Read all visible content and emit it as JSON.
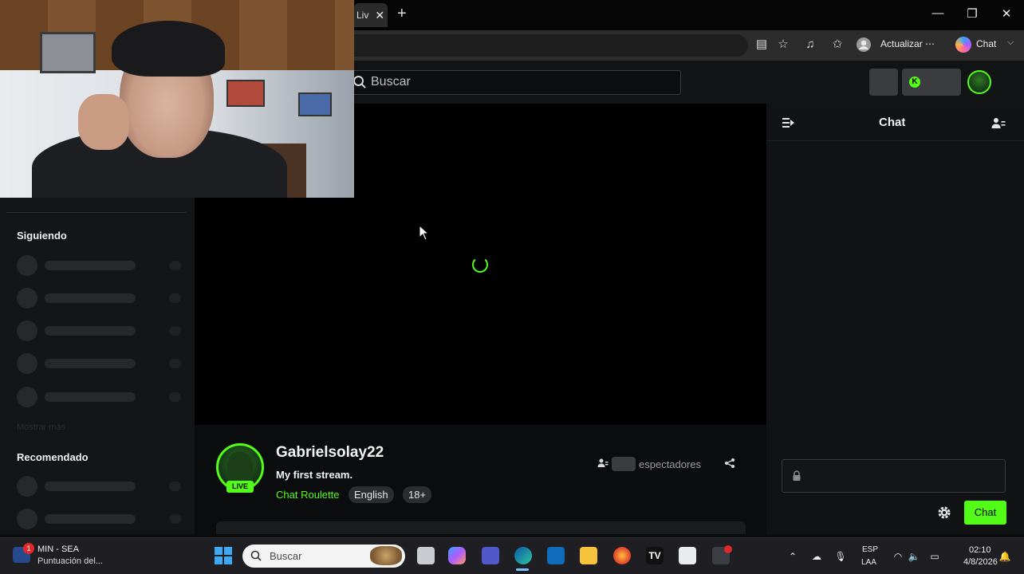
{
  "browser": {
    "tab_title": "Liv",
    "tab_close": "✕",
    "new_tab": "+",
    "update_label": "Actualizar",
    "update_more": "⋯",
    "copilot_label": "Chat",
    "window_min": "—",
    "window_max": "❐",
    "window_close": "✕"
  },
  "header": {
    "search_placeholder": "Buscar"
  },
  "sidebar": {
    "following_heading": "Siguiendo",
    "show_more": "Mostrar más",
    "recommended_heading": "Recomendado"
  },
  "stream": {
    "streamer_name": "Gabrielsolay22",
    "title": "My first stream.",
    "category": "Chat Roulette",
    "tags": [
      "English",
      "18+"
    ],
    "live_badge": "LIVE",
    "viewers_label": "espectadores"
  },
  "chat": {
    "title": "Chat",
    "send_label": "Chat"
  },
  "taskbar": {
    "weather_title": "MIN - SEA",
    "weather_sub": "Puntuación del...",
    "weather_badge": "1",
    "search_label": "Buscar",
    "lang_top": "ESP",
    "lang_bottom": "LAA",
    "time": "02:10",
    "date": "4/8/2026"
  },
  "colors": {
    "accent": "#53fc18",
    "background": "#0b0c0d"
  },
  "icons": [
    "search-icon",
    "kick-icon",
    "collapse-chat-icon",
    "chat-users-icon",
    "lock-icon",
    "settings-icon",
    "viewer-icon",
    "share-icon"
  ]
}
